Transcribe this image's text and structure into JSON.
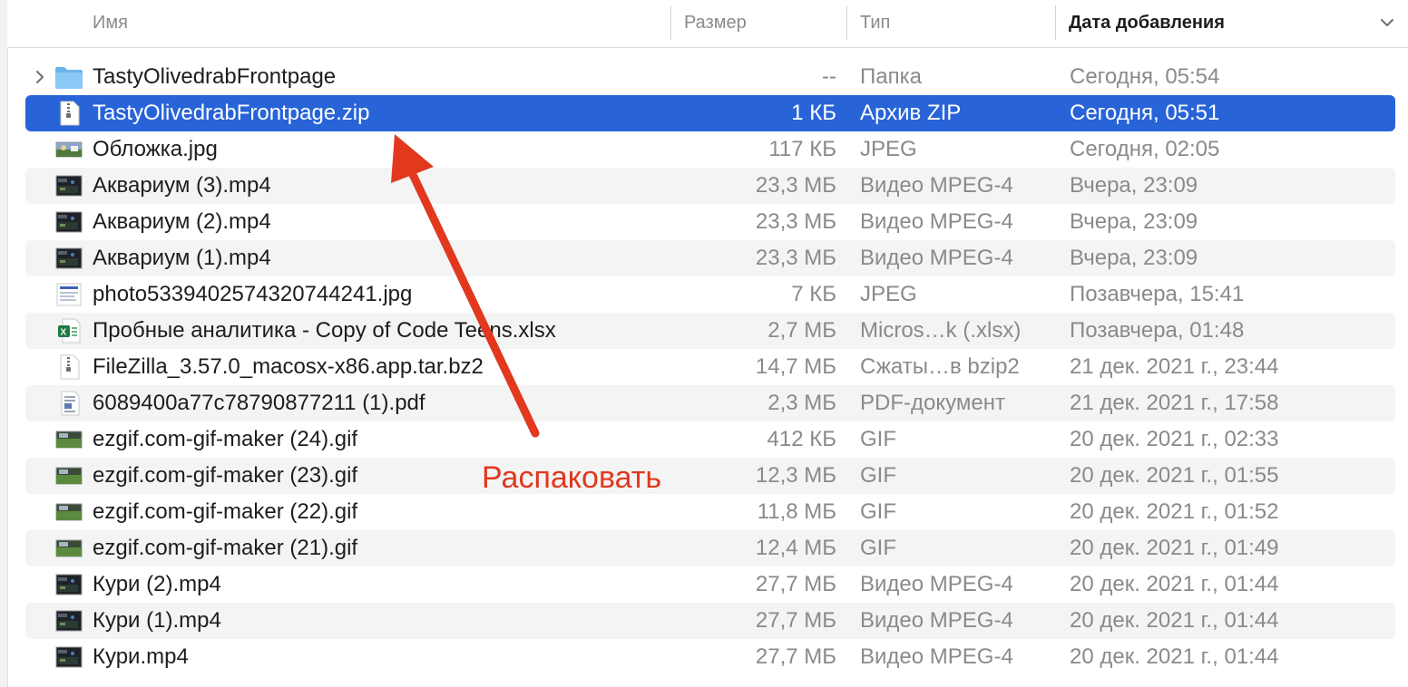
{
  "header": {
    "name": "Имя",
    "size": "Размер",
    "kind": "Тип",
    "date_added": "Дата добавления"
  },
  "files": [
    {
      "name": "TastyOlivedrabFrontpage",
      "size": "--",
      "kind": "Папка",
      "date": "Сегодня, 05:54",
      "icon": "folder-icon",
      "expandable": true
    },
    {
      "name": "TastyOlivedrabFrontpage.zip",
      "size": "1 КБ",
      "kind": "Архив ZIP",
      "date": "Сегодня, 05:51",
      "icon": "zip-file-icon",
      "selected": true
    },
    {
      "name": "Обложка.jpg",
      "size": "117 КБ",
      "kind": "JPEG",
      "date": "Сегодня, 02:05",
      "icon": "image-thumbnail-icon"
    },
    {
      "name": "Аквариум (3).mp4",
      "size": "23,3 МБ",
      "kind": "Видео MPEG-4",
      "date": "Вчера, 23:09",
      "icon": "video-thumbnail-icon"
    },
    {
      "name": "Аквариум (2).mp4",
      "size": "23,3 МБ",
      "kind": "Видео MPEG-4",
      "date": "Вчера, 23:09",
      "icon": "video-thumbnail-icon"
    },
    {
      "name": "Аквариум (1).mp4",
      "size": "23,3 МБ",
      "kind": "Видео MPEG-4",
      "date": "Вчера, 23:09",
      "icon": "video-thumbnail-icon"
    },
    {
      "name": "photo5339402574320744241.jpg",
      "size": "7 КБ",
      "kind": "JPEG",
      "date": "Позавчера, 15:41",
      "icon": "image-document-icon"
    },
    {
      "name": "Пробные аналитика - Copy of Code Teens.xlsx",
      "size": "2,7 МБ",
      "kind": "Micros…k (.xlsx)",
      "date": "Позавчера, 01:48",
      "icon": "excel-file-icon"
    },
    {
      "name": "FileZilla_3.57.0_macosx-x86.app.tar.bz2",
      "size": "14,7 МБ",
      "kind": "Сжаты…в bzip2",
      "date": "21 дек. 2021 г., 23:44",
      "icon": "archive-file-icon"
    },
    {
      "name": "6089400a77c78790877211 (1).pdf",
      "size": "2,3 МБ",
      "kind": "PDF-документ",
      "date": "21 дек. 2021 г., 17:58",
      "icon": "pdf-file-icon"
    },
    {
      "name": "ezgif.com-gif-maker (24).gif",
      "size": "412 КБ",
      "kind": "GIF",
      "date": "20 дек. 2021 г., 02:33",
      "icon": "gif-thumbnail-icon"
    },
    {
      "name": "ezgif.com-gif-maker (23).gif",
      "size": "12,3 МБ",
      "kind": "GIF",
      "date": "20 дек. 2021 г., 01:55",
      "icon": "gif-thumbnail-icon"
    },
    {
      "name": "ezgif.com-gif-maker (22).gif",
      "size": "11,8 МБ",
      "kind": "GIF",
      "date": "20 дек. 2021 г., 01:52",
      "icon": "gif-thumbnail-icon"
    },
    {
      "name": "ezgif.com-gif-maker (21).gif",
      "size": "12,4 МБ",
      "kind": "GIF",
      "date": "20 дек. 2021 г., 01:49",
      "icon": "gif-thumbnail-icon"
    },
    {
      "name": "Кури (2).mp4",
      "size": "27,7 МБ",
      "kind": "Видео MPEG-4",
      "date": "20 дек. 2021 г., 01:44",
      "icon": "video-thumbnail-icon"
    },
    {
      "name": "Кури (1).mp4",
      "size": "27,7 МБ",
      "kind": "Видео MPEG-4",
      "date": "20 дек. 2021 г., 01:44",
      "icon": "video-thumbnail-icon"
    },
    {
      "name": "Кури.mp4",
      "size": "27,7 МБ",
      "kind": "Видео MPEG-4",
      "date": "20 дек. 2021 г., 01:44",
      "icon": "video-thumbnail-icon"
    }
  ],
  "annotation": {
    "label": "Распаковать",
    "color": "#e1381e"
  },
  "colors": {
    "selection": "#2864d8",
    "alt_row": "#f4f4f5",
    "secondary_text": "#8a8a8a"
  }
}
